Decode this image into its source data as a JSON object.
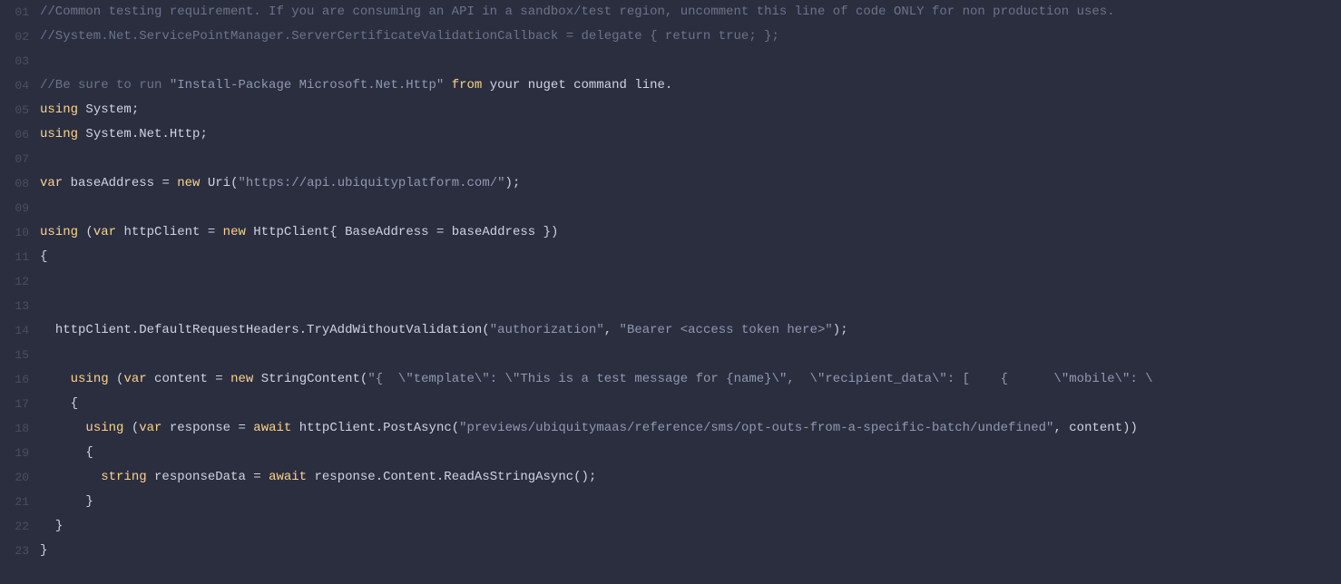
{
  "lines": [
    {
      "num": "01",
      "tokens": [
        {
          "cls": "comment",
          "t": "//Common testing requirement. If you are consuming an API in a sandbox/test region, uncomment this line of code ONLY for non production uses."
        }
      ]
    },
    {
      "num": "02",
      "tokens": [
        {
          "cls": "comment",
          "t": "//System.Net.ServicePointManager.ServerCertificateValidationCallback = delegate { return true; };"
        }
      ]
    },
    {
      "num": "03",
      "tokens": []
    },
    {
      "num": "04",
      "tokens": [
        {
          "cls": "comment",
          "t": "//Be sure to run "
        },
        {
          "cls": "string",
          "t": "\"Install-Package Microsoft.Net.Http\""
        },
        {
          "cls": "comment",
          "t": " "
        },
        {
          "cls": "keyword",
          "t": "from"
        },
        {
          "cls": "comment",
          "t": " "
        },
        {
          "cls": "ident",
          "t": "your nuget command line."
        }
      ]
    },
    {
      "num": "05",
      "tokens": [
        {
          "cls": "keyword",
          "t": "using "
        },
        {
          "cls": "type",
          "t": "System"
        },
        {
          "cls": "punct",
          "t": ";"
        }
      ]
    },
    {
      "num": "06",
      "tokens": [
        {
          "cls": "keyword",
          "t": "using "
        },
        {
          "cls": "type",
          "t": "System.Net.Http"
        },
        {
          "cls": "punct",
          "t": ";"
        }
      ]
    },
    {
      "num": "07",
      "tokens": []
    },
    {
      "num": "08",
      "tokens": [
        {
          "cls": "keyword",
          "t": "var "
        },
        {
          "cls": "ident",
          "t": "baseAddress "
        },
        {
          "cls": "punct",
          "t": "= "
        },
        {
          "cls": "keyword",
          "t": "new "
        },
        {
          "cls": "type",
          "t": "Uri"
        },
        {
          "cls": "punct",
          "t": "("
        },
        {
          "cls": "string",
          "t": "\"https://api.ubiquityplatform.com/\""
        },
        {
          "cls": "punct",
          "t": ");"
        }
      ]
    },
    {
      "num": "09",
      "tokens": []
    },
    {
      "num": "10",
      "tokens": [
        {
          "cls": "keyword",
          "t": "using "
        },
        {
          "cls": "punct",
          "t": "("
        },
        {
          "cls": "keyword",
          "t": "var "
        },
        {
          "cls": "ident",
          "t": "httpClient "
        },
        {
          "cls": "punct",
          "t": "= "
        },
        {
          "cls": "keyword",
          "t": "new "
        },
        {
          "cls": "type",
          "t": "HttpClient"
        },
        {
          "cls": "punct",
          "t": "{ "
        },
        {
          "cls": "ident",
          "t": "BaseAddress "
        },
        {
          "cls": "punct",
          "t": "= "
        },
        {
          "cls": "ident",
          "t": "baseAddress "
        },
        {
          "cls": "punct",
          "t": "})"
        }
      ]
    },
    {
      "num": "11",
      "tokens": [
        {
          "cls": "punct",
          "t": "{"
        }
      ]
    },
    {
      "num": "12",
      "tokens": []
    },
    {
      "num": "13",
      "tokens": []
    },
    {
      "num": "14",
      "tokens": [
        {
          "cls": "plain",
          "t": "  "
        },
        {
          "cls": "ident",
          "t": "httpClient.DefaultRequestHeaders.TryAddWithoutValidation"
        },
        {
          "cls": "punct",
          "t": "("
        },
        {
          "cls": "string",
          "t": "\"authorization\""
        },
        {
          "cls": "punct",
          "t": ", "
        },
        {
          "cls": "string",
          "t": "\"Bearer <access token here>\""
        },
        {
          "cls": "punct",
          "t": ");"
        }
      ]
    },
    {
      "num": "15",
      "tokens": []
    },
    {
      "num": "16",
      "tokens": [
        {
          "cls": "plain",
          "t": "    "
        },
        {
          "cls": "keyword",
          "t": "using "
        },
        {
          "cls": "punct",
          "t": "("
        },
        {
          "cls": "keyword",
          "t": "var "
        },
        {
          "cls": "ident",
          "t": "content "
        },
        {
          "cls": "punct",
          "t": "= "
        },
        {
          "cls": "keyword",
          "t": "new "
        },
        {
          "cls": "type",
          "t": "StringContent"
        },
        {
          "cls": "punct",
          "t": "("
        },
        {
          "cls": "string",
          "t": "\"{  \\\"template\\\": \\\"This is a test message for {name}\\\",  \\\"recipient_data\\\": [    {      \\\"mobile\\\": \\"
        }
      ]
    },
    {
      "num": "17",
      "tokens": [
        {
          "cls": "plain",
          "t": "    "
        },
        {
          "cls": "punct",
          "t": "{"
        }
      ]
    },
    {
      "num": "18",
      "tokens": [
        {
          "cls": "plain",
          "t": "      "
        },
        {
          "cls": "keyword",
          "t": "using "
        },
        {
          "cls": "punct",
          "t": "("
        },
        {
          "cls": "keyword",
          "t": "var "
        },
        {
          "cls": "ident",
          "t": "response "
        },
        {
          "cls": "punct",
          "t": "= "
        },
        {
          "cls": "keyword",
          "t": "await "
        },
        {
          "cls": "ident",
          "t": "httpClient.PostAsync"
        },
        {
          "cls": "punct",
          "t": "("
        },
        {
          "cls": "string",
          "t": "\"previews/ubiquitymaas/reference/sms/opt-outs-from-a-specific-batch/undefined\""
        },
        {
          "cls": "punct",
          "t": ", "
        },
        {
          "cls": "ident",
          "t": "content"
        },
        {
          "cls": "punct",
          "t": "))"
        }
      ]
    },
    {
      "num": "19",
      "tokens": [
        {
          "cls": "plain",
          "t": "      "
        },
        {
          "cls": "punct",
          "t": "{"
        }
      ]
    },
    {
      "num": "20",
      "tokens": [
        {
          "cls": "plain",
          "t": "        "
        },
        {
          "cls": "keyword",
          "t": "string "
        },
        {
          "cls": "ident",
          "t": "responseData "
        },
        {
          "cls": "punct",
          "t": "= "
        },
        {
          "cls": "keyword",
          "t": "await "
        },
        {
          "cls": "ident",
          "t": "response.Content.ReadAsStringAsync"
        },
        {
          "cls": "punct",
          "t": "();"
        }
      ]
    },
    {
      "num": "21",
      "tokens": [
        {
          "cls": "plain",
          "t": "      "
        },
        {
          "cls": "punct",
          "t": "}"
        }
      ]
    },
    {
      "num": "22",
      "tokens": [
        {
          "cls": "plain",
          "t": "  "
        },
        {
          "cls": "punct",
          "t": "}"
        }
      ]
    },
    {
      "num": "23",
      "tokens": [
        {
          "cls": "punct",
          "t": "}"
        }
      ]
    }
  ]
}
